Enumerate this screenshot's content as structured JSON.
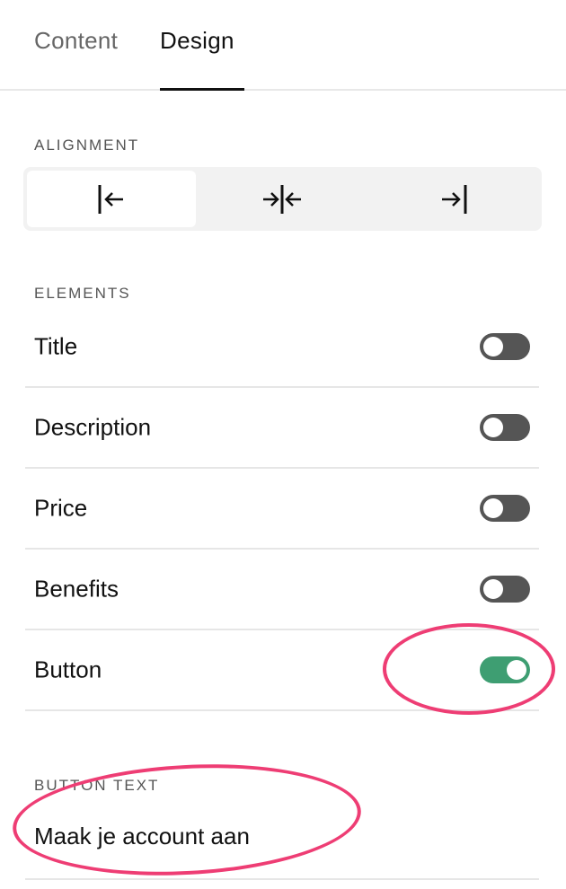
{
  "tabs": [
    {
      "label": "Content",
      "active": false
    },
    {
      "label": "Design",
      "active": true
    }
  ],
  "alignment": {
    "label": "ALIGNMENT",
    "options": [
      "left",
      "center",
      "right"
    ],
    "selected": "left"
  },
  "elements": {
    "label": "ELEMENTS",
    "items": [
      {
        "label": "Title",
        "on": false
      },
      {
        "label": "Description",
        "on": false
      },
      {
        "label": "Price",
        "on": false
      },
      {
        "label": "Benefits",
        "on": false
      },
      {
        "label": "Button",
        "on": true
      }
    ]
  },
  "button_text": {
    "label": "BUTTON TEXT",
    "value": "Maak je account aan"
  },
  "colors": {
    "toggle_on": "#3e9e72",
    "toggle_off": "#555555",
    "annotation": "#ee3d74"
  }
}
